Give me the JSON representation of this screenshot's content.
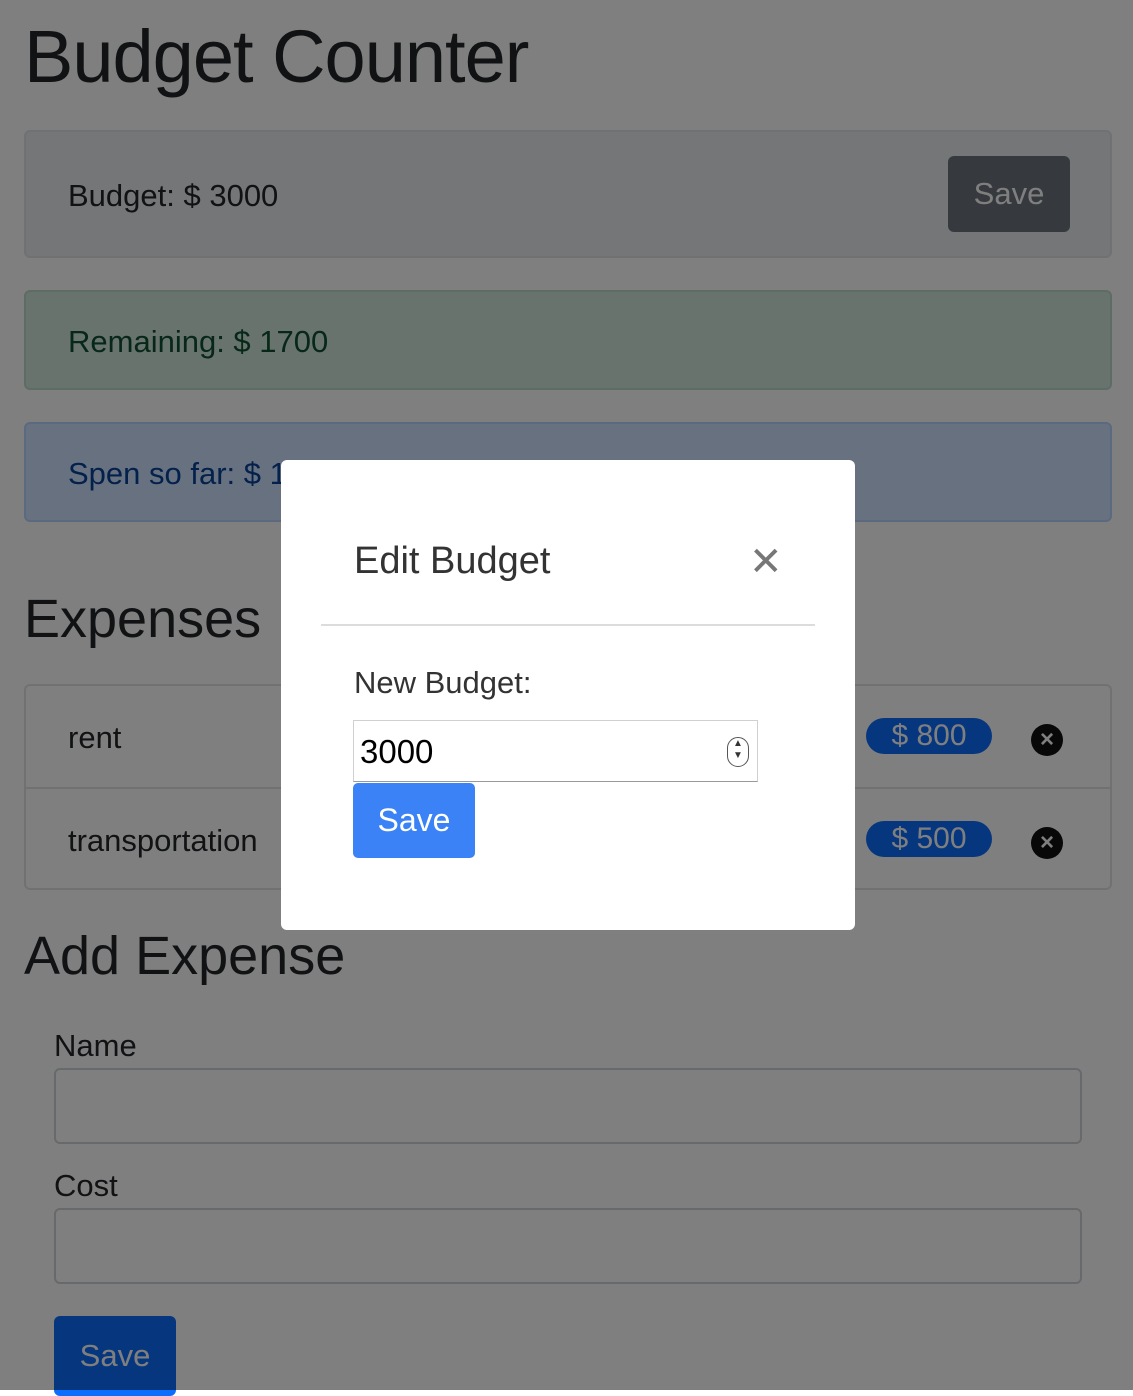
{
  "app": {
    "title": "Budget Counter"
  },
  "budget": {
    "label": "Budget: $ 3000",
    "save_label": "Save"
  },
  "remaining": {
    "label": "Remaining: $ 1700"
  },
  "spent": {
    "label": "Spen so far: $ 1300"
  },
  "expenses": {
    "heading": "Expenses",
    "items": [
      {
        "name": "rent",
        "cost": "$ 800"
      },
      {
        "name": "transportation",
        "cost": "$ 500"
      }
    ]
  },
  "add_expense": {
    "heading": "Add Expense",
    "name_label": "Name",
    "name_value": "",
    "cost_label": "Cost",
    "cost_value": "",
    "save_label": "Save"
  },
  "modal": {
    "title": "Edit Budget",
    "close_glyph": "✕",
    "field_label": "New Budget:",
    "field_value": "3000",
    "save_label": "Save"
  },
  "colors": {
    "primary": "#0d6efd",
    "secondary": "#6c757d",
    "success_bg": "#d1e7dd",
    "info_bg": "#cfe2ff",
    "overlay": "rgba(0,0,0,0.5)"
  }
}
